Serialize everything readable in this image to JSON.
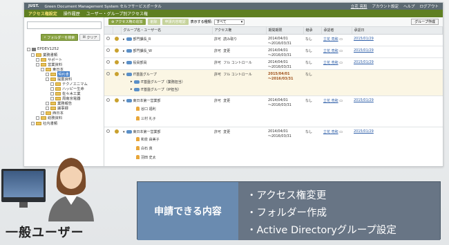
{
  "topbar": {
    "logo": "JUST.",
    "title": "Green Document Management System セルフサービスポータル",
    "user": "立花 亮和",
    "menu": [
      "アカウント設定",
      "ヘルプ",
      "ログアウト"
    ]
  },
  "menubar": [
    "アクセス権設定",
    "操作履歴",
    "ユーザー・グループ別アクセス権"
  ],
  "left": {
    "folder_search_btn": "フォルダーを検索",
    "clear_btn": "クリア",
    "tree": [
      "EPDEV1252",
      "業務書類",
      "サポート",
      "営業資料",
      "東日本",
      "契約書",
      "提案資料",
      "テクノエニマム",
      "ハッピー生命",
      "佐々木工業",
      "周南京電器",
      "業務報告",
      "議事録",
      "西日本",
      "総務資料",
      "社内書類"
    ]
  },
  "toolbar": {
    "add_btn": "アクセス権の追加",
    "delete_btn": "削除",
    "request_btn": "申請内容確認",
    "display_label": "表示する種類:",
    "display_value": "すべて",
    "group_create_btn": "グループ作成"
  },
  "table": {
    "headers": [
      "",
      "",
      "グループ名・ユーザー名",
      "アクセス権",
      "期間期限",
      "継承",
      "承認者",
      "承認日"
    ],
    "rows": [
      {
        "name": "部門課長_R",
        "perm": "許可",
        "perm2": "読み取り",
        "period": [
          "2014/04/01",
          "～2016/03/31"
        ],
        "inherit": "なし",
        "approver": "立花 亮和",
        "date": "2015/01/29"
      },
      {
        "name": "部門課長_W",
        "perm": "許可",
        "perm2": "変更",
        "period": [
          "2014/04/01",
          "～2016/03/31"
        ],
        "inherit": "なし",
        "approver": "立花 亮和",
        "date": "2015/01/29"
      },
      {
        "name": "役員部員",
        "perm": "許可",
        "perm2": "フル コントロール",
        "period": [
          "2014/04/01",
          "～2016/03/31"
        ],
        "inherit": "なし",
        "approver": "立花 亮和",
        "date": "2015/01/29"
      },
      {
        "name": "IT基盤グループ",
        "perm": "許可",
        "perm2": "フル コントロール",
        "period": [
          "2015/04/01",
          "～2016/03/31"
        ],
        "inherit": "なし",
        "approver": "",
        "date": ""
      },
      {
        "name": "東日本第一営業部",
        "perm": "許可",
        "perm2": "変更",
        "period": [
          "2014/04/01",
          "～2016/03/31"
        ],
        "inherit": "なし",
        "approver": "立花 亮和",
        "date": "2015/01/29"
      },
      {
        "name": "東日本第一営業部",
        "perm": "許可",
        "perm2": "変更",
        "period": [
          "2014/04/01",
          "～2016/03/31"
        ],
        "inherit": "なし",
        "approver": "立花 亮和",
        "date": "2015/01/29"
      }
    ],
    "subgroups": [
      "IT基盤グループ（業務担当）",
      "IT基盤グループ（IP担当）"
    ],
    "members1": [
      "谷口 福利",
      "三村 礼子"
    ],
    "members2": [
      "和泉 由美子",
      "白石 真",
      "羽田 史太"
    ]
  },
  "callout": {
    "heading": "申請できる内容",
    "items": [
      "・アクセス権変更",
      "・フォルダー作成",
      "・Active Directoryグループ設定"
    ]
  },
  "role": "一般ユーザー"
}
